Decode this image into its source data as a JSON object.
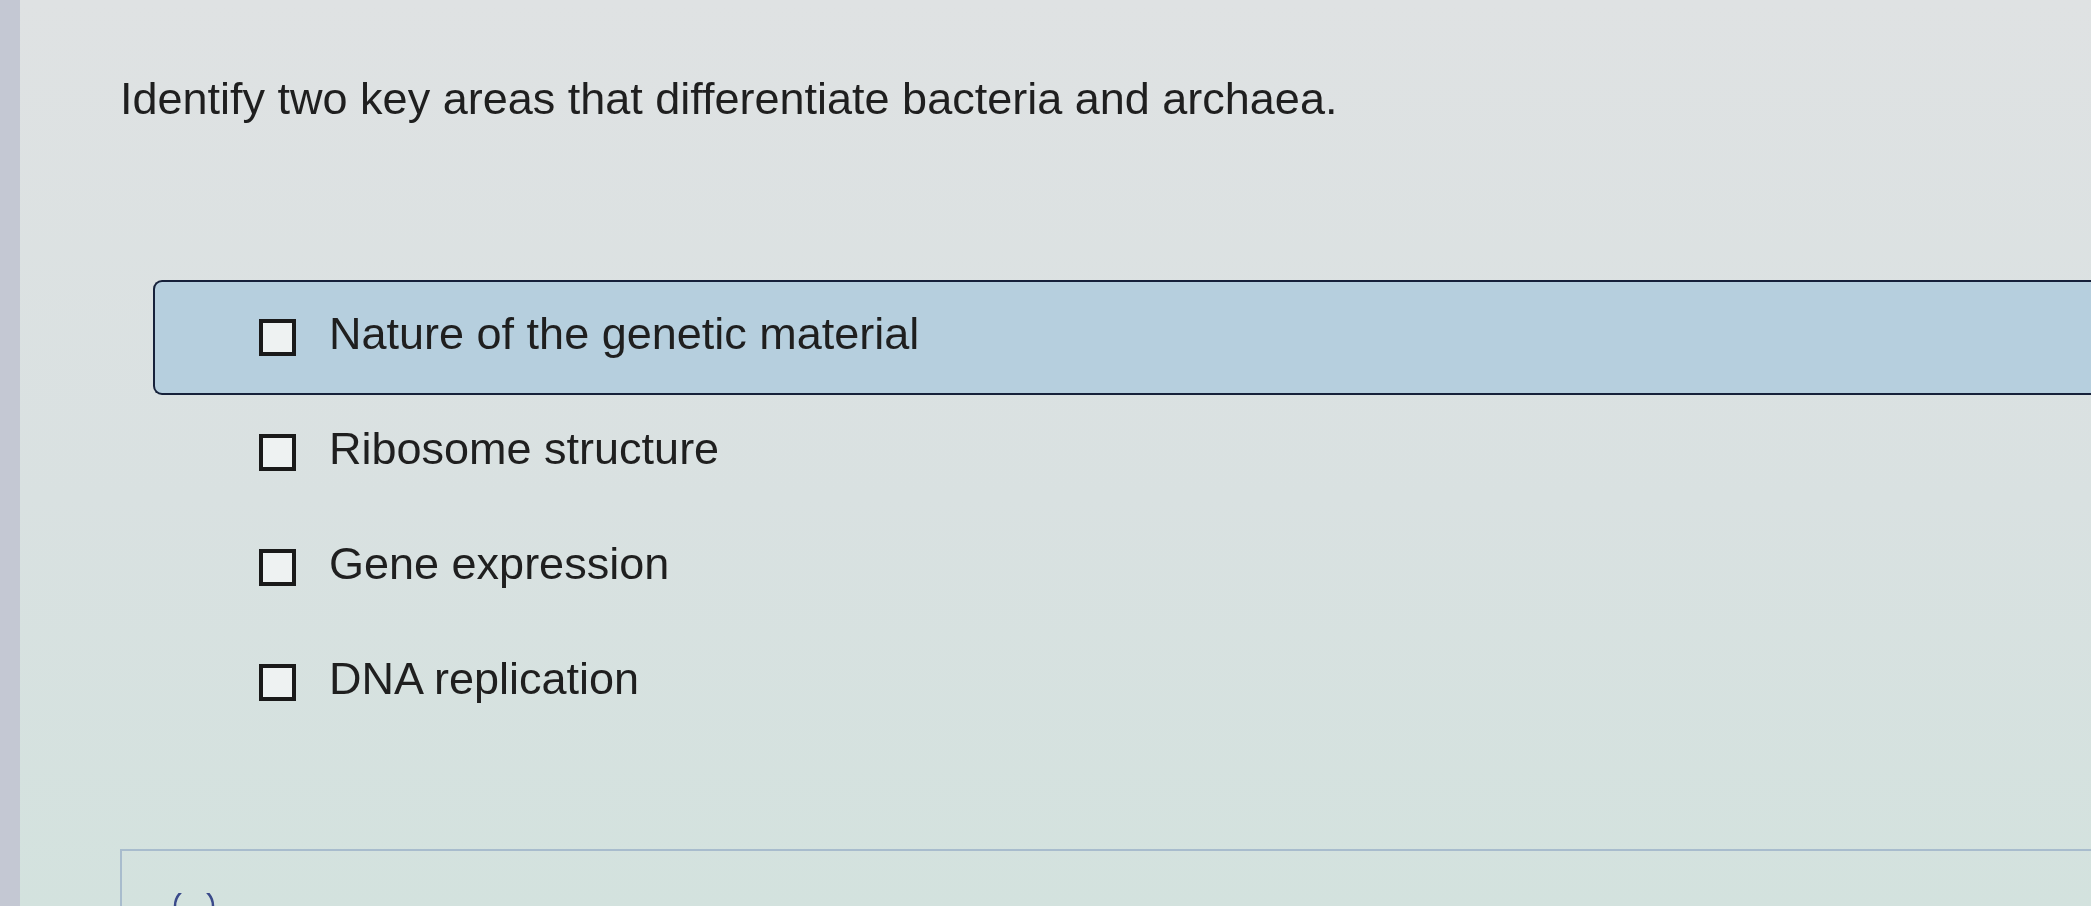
{
  "question": "Identify two key areas that differentiate bacteria and archaea.",
  "options": [
    {
      "label": "Nature of the genetic material",
      "checked": false,
      "highlighted": true
    },
    {
      "label": "Ribosome structure",
      "checked": false,
      "highlighted": false
    },
    {
      "label": "Gene expression",
      "checked": false,
      "highlighted": false
    },
    {
      "label": "DNA replication",
      "checked": false,
      "highlighted": false
    }
  ]
}
